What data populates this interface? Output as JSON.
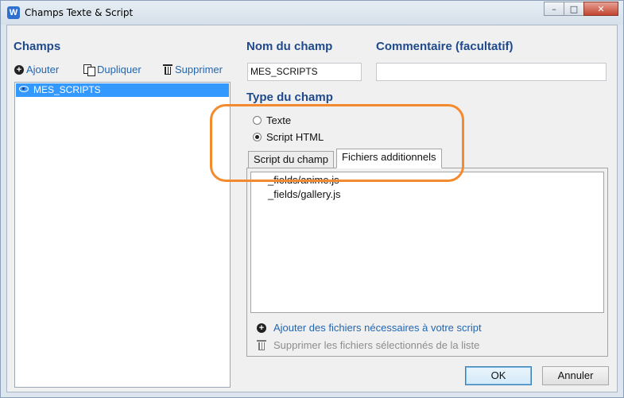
{
  "window": {
    "title": "Champs Texte & Script",
    "app_icon": "W"
  },
  "colors": {
    "accent_title": "#1e4a8c",
    "link": "#2366b0",
    "selection": "#3399ff",
    "highlight": "#f48a2d"
  },
  "left_panel": {
    "title": "Champs",
    "toolbar": {
      "add_label": "Ajouter",
      "duplicate_label": "Dupliquer",
      "delete_label": "Supprimer"
    },
    "fields": [
      {
        "label": "MES_SCRIPTS",
        "icon": "eye-icon",
        "selected": true
      }
    ]
  },
  "field_name": {
    "label": "Nom du champ",
    "value": "MES_SCRIPTS"
  },
  "comment": {
    "label": "Commentaire (facultatif)",
    "value": ""
  },
  "field_type": {
    "label": "Type du champ",
    "options": [
      {
        "label": "Texte",
        "checked": false
      },
      {
        "label": "Script HTML",
        "checked": true
      }
    ]
  },
  "tabs": [
    {
      "label": "Script du champ",
      "active": false
    },
    {
      "label": "Fichiers additionnels",
      "active": true
    }
  ],
  "files": [
    "_fields/anime.js",
    "_fields/gallery.js"
  ],
  "actions": {
    "add_files": "Ajouter des fichiers nécessaires à votre script",
    "remove_files": "Supprimer les fichiers sélectionnés de la liste"
  },
  "buttons": {
    "ok": "OK",
    "cancel": "Annuler"
  },
  "window_controls": {
    "minimize": "–",
    "maximize": "□",
    "close": "✕"
  }
}
